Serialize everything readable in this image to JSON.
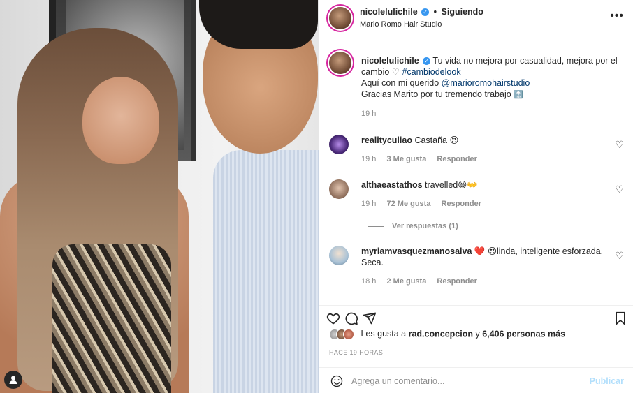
{
  "post": {
    "username": "nicolelulichile",
    "follow_status": "Siguiendo",
    "location": "Mario Romo Hair Studio",
    "caption_main": "Tu vida no mejora por casualidad, mejora por el cambio",
    "caption_hashtag": "#cambiodelook",
    "caption_line2_prefix": "Aquí con mi querido ",
    "caption_mention": "@marioromohairstudio",
    "caption_line3": "Gracias Marito por tu tremendo trabajo",
    "caption_time": "19 h"
  },
  "comments": [
    {
      "user": "realityculiao",
      "text": "Castaña 😍",
      "time": "19 h",
      "likes": "3 Me gusta",
      "reply": "Responder"
    },
    {
      "user": "althaeastathos",
      "text": "travelled😆👐",
      "time": "19 h",
      "likes": "72 Me gusta",
      "reply": "Responder",
      "view_replies": "Ver respuestas (1)"
    },
    {
      "user": "myriamvasquezmanosalva",
      "text": "❤️ 😍linda, inteligente esforzada. Seca.",
      "time": "18 h",
      "likes": "2 Me gusta",
      "reply": "Responder"
    }
  ],
  "likes_line": {
    "prefix": "Les gusta a",
    "user": "rad.concepcion",
    "middle": "y",
    "count": "6,406 personas más"
  },
  "timestamp": "HACE 19 HORAS",
  "add_comment": {
    "placeholder": "Agrega un comentario...",
    "publish": "Publicar"
  },
  "icons": {
    "verified": "verified-badge-icon",
    "more": "more-options-icon",
    "like": "heart-outline-icon",
    "comment": "comment-bubble-icon",
    "share": "paper-plane-icon",
    "save": "bookmark-icon",
    "emoji": "emoji-smile-icon"
  },
  "colors": {
    "link": "#00376b",
    "secondary_text": "#8e8e8e",
    "publish_disabled": "#b2dffc",
    "verified": "#3897f0"
  }
}
